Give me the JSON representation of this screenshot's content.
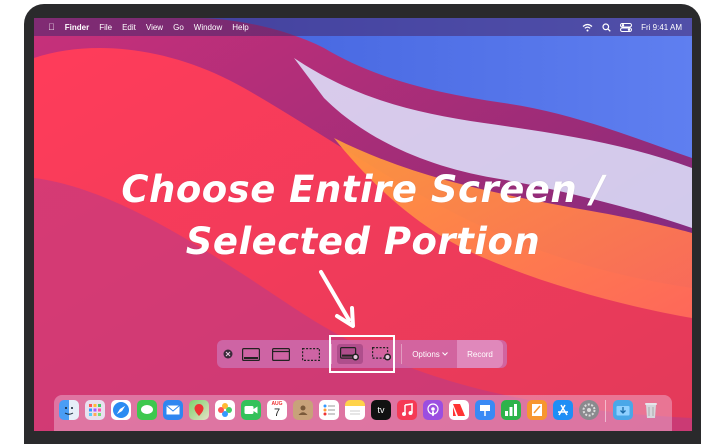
{
  "menubar": {
    "apple": "",
    "app": "Finder",
    "menus": [
      "File",
      "Edit",
      "View",
      "Go",
      "Window",
      "Help"
    ],
    "clock": "Fri 9:41 AM"
  },
  "overlay": {
    "line1": "Choose Entire Screen /",
    "line2": "Selected Portion"
  },
  "toolbar": {
    "options_label": "Options",
    "record_label": "Record",
    "highlighted_section": "record-capture-buttons"
  },
  "dock": {
    "apps": [
      "finder",
      "launchpad",
      "safari",
      "messages",
      "mail",
      "maps",
      "photos",
      "facetime",
      "calendar",
      "contacts",
      "reminders",
      "notes",
      "apple-tv",
      "music",
      "podcasts",
      "news",
      "keynote",
      "numbers",
      "pages",
      "app-store",
      "system-preferences",
      "downloads",
      "trash"
    ],
    "calendar_month": "AUG",
    "calendar_day": "7",
    "tv_label": "tv"
  },
  "colors": {
    "toolbar_bg": "#cd6eaf",
    "highlight_border": "#ffffff",
    "menubar_bg": "#46286e"
  }
}
